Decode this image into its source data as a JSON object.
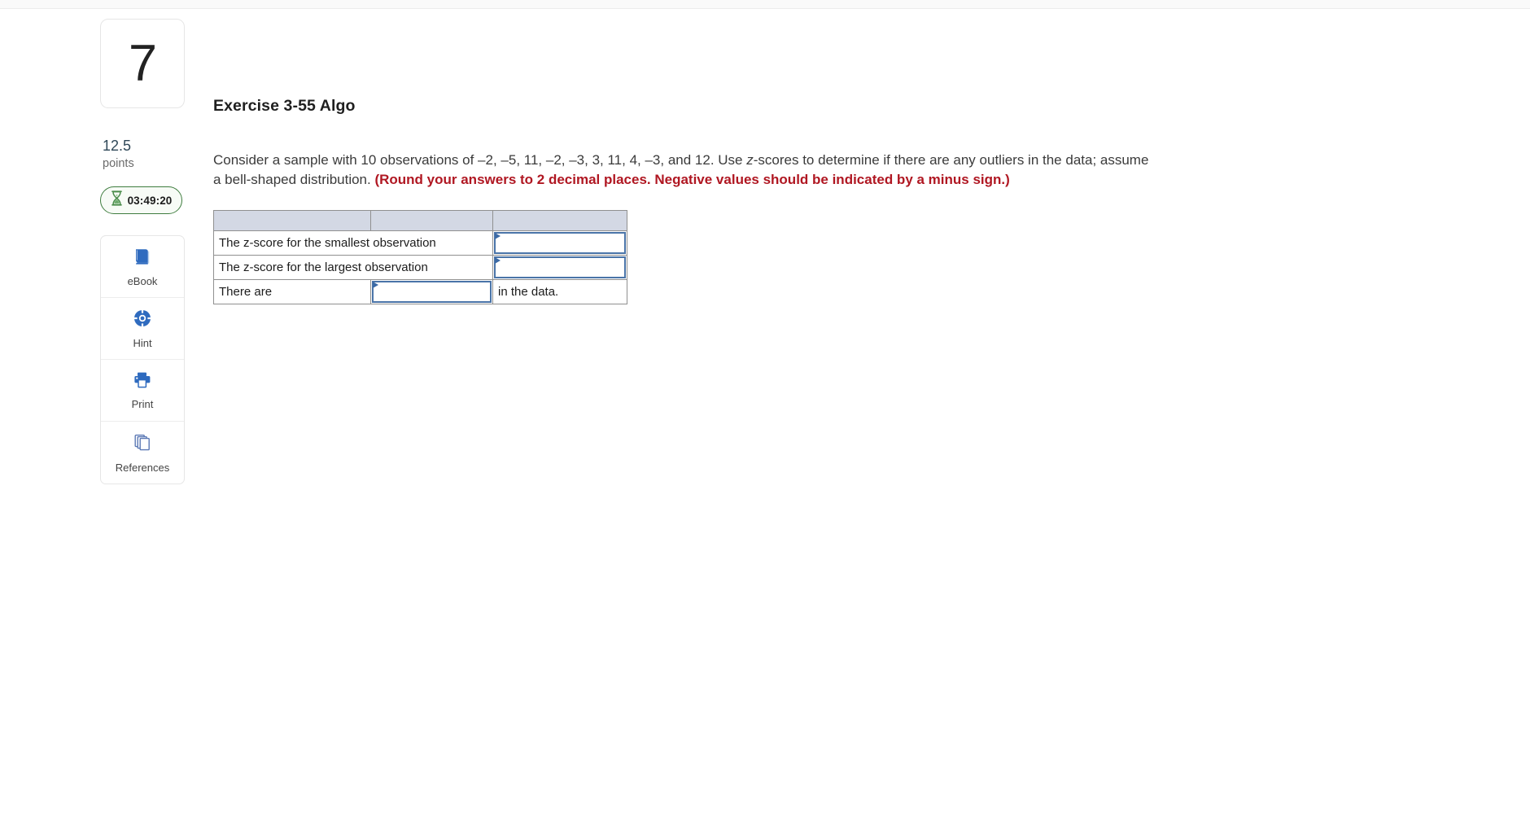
{
  "question": {
    "number": "7",
    "points_value": "12.5",
    "points_label": "points",
    "timer": "03:49:20",
    "timer_icon": "hourglass-icon",
    "title": "Exercise 3-55 Algo"
  },
  "tools": [
    {
      "label": "eBook",
      "icon": "book-icon"
    },
    {
      "label": "Hint",
      "icon": "life-ring-icon"
    },
    {
      "label": "Print",
      "icon": "printer-icon"
    },
    {
      "label": "References",
      "icon": "pages-stack-icon"
    }
  ],
  "prompt": {
    "part1": "Consider a sample with 10 observations of –2, –5, 11, –2, –3, 3, 11, 4, –3, and 12. Use ",
    "italic": "z",
    "part2": "-scores to determine if there are any outliers in the data; assume a bell-shaped distribution. ",
    "emphasis": "(Round your answers to 2 decimal places. Negative values should be indicated by a minus sign.)"
  },
  "answer_table": {
    "header_cells": [
      "",
      "",
      ""
    ],
    "rows": [
      {
        "id": "smallest",
        "label": "The z-score for the smallest observation",
        "input_value": "",
        "trailing_text": null,
        "layout": "label-span2-input"
      },
      {
        "id": "largest",
        "label": "The z-score for the largest observation",
        "input_value": "",
        "trailing_text": null,
        "layout": "label-span2-input"
      },
      {
        "id": "outlier-count",
        "label": "There are",
        "input_value": "",
        "trailing_text": "in the data.",
        "layout": "label-input-text"
      }
    ]
  },
  "colors": {
    "accent_red": "#b01722",
    "table_header": "#d3d8e4",
    "input_border": "#4a74a8",
    "timer_green": "#3f7d3f",
    "points_navy": "#2f4858",
    "icon_blue": "#2f6bbf"
  }
}
